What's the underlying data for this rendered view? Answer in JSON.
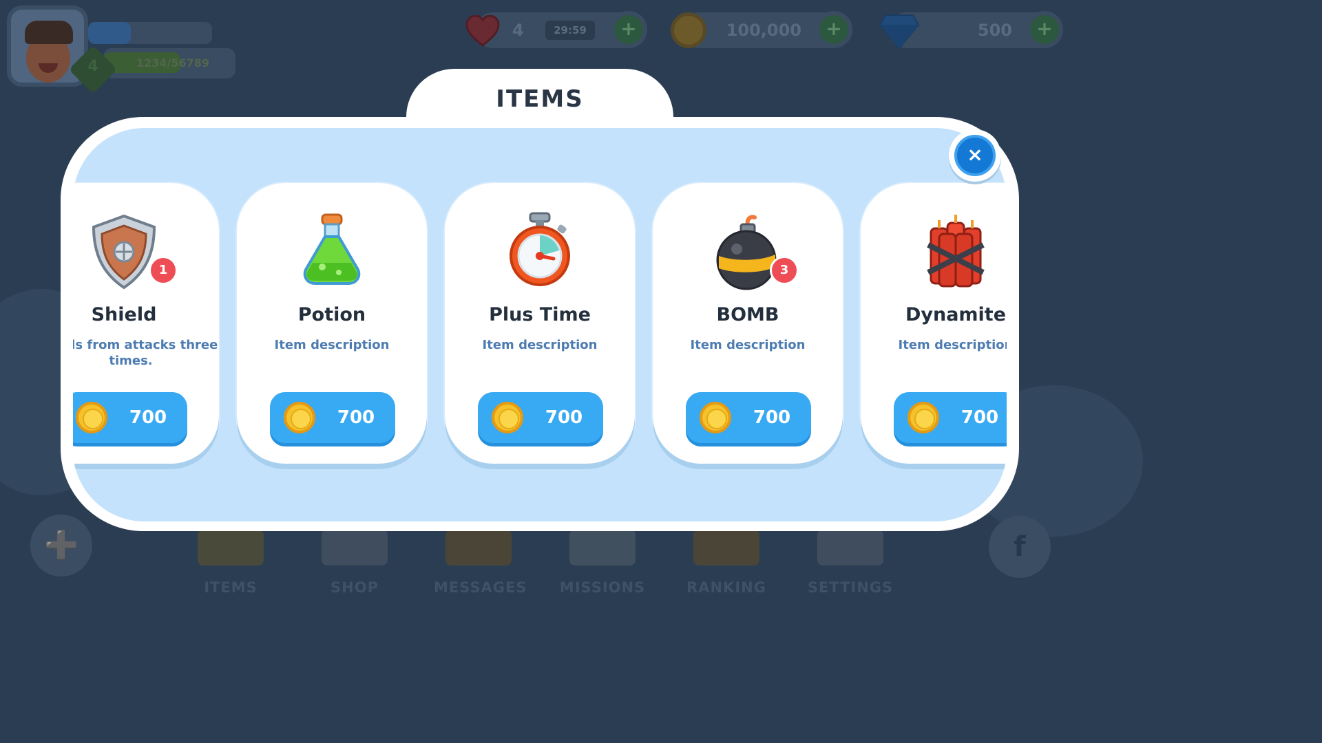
{
  "hud": {
    "level": "4",
    "xp_text": "1234/56789",
    "lives": "4",
    "timer": "29:59",
    "coins": "100,000",
    "gems": "500",
    "plus_symbol": "+"
  },
  "nav": {
    "items": [
      "ITEMS",
      "SHOP",
      "MESSAGES",
      "MISSIONS",
      "RANKING",
      "SETTINGS"
    ]
  },
  "modal": {
    "title": "ITEMS",
    "close_symbol": "×"
  },
  "items": [
    {
      "name": "Shield",
      "description": "fends from attacks three times.",
      "price": "700",
      "badge": "1",
      "icon": "shield-icon"
    },
    {
      "name": "Potion",
      "description": "Item description",
      "price": "700",
      "badge": "",
      "icon": "potion-icon"
    },
    {
      "name": "Plus Time",
      "description": "Item description",
      "price": "700",
      "badge": "",
      "icon": "stopwatch-icon"
    },
    {
      "name": "BOMB",
      "description": "Item description",
      "price": "700",
      "badge": "3",
      "icon": "bomb-icon"
    },
    {
      "name": "Dynamite",
      "description": "Item description",
      "price": "700",
      "badge": "",
      "icon": "dynamite-icon"
    }
  ],
  "colors": {
    "background": "#2b3d52",
    "modal_inner": "#c4e2fb",
    "button_blue": "#38a9f3",
    "badge_red": "#ef4d55",
    "close_blue": "#1479d4",
    "description_blue": "#4d7cb1"
  }
}
